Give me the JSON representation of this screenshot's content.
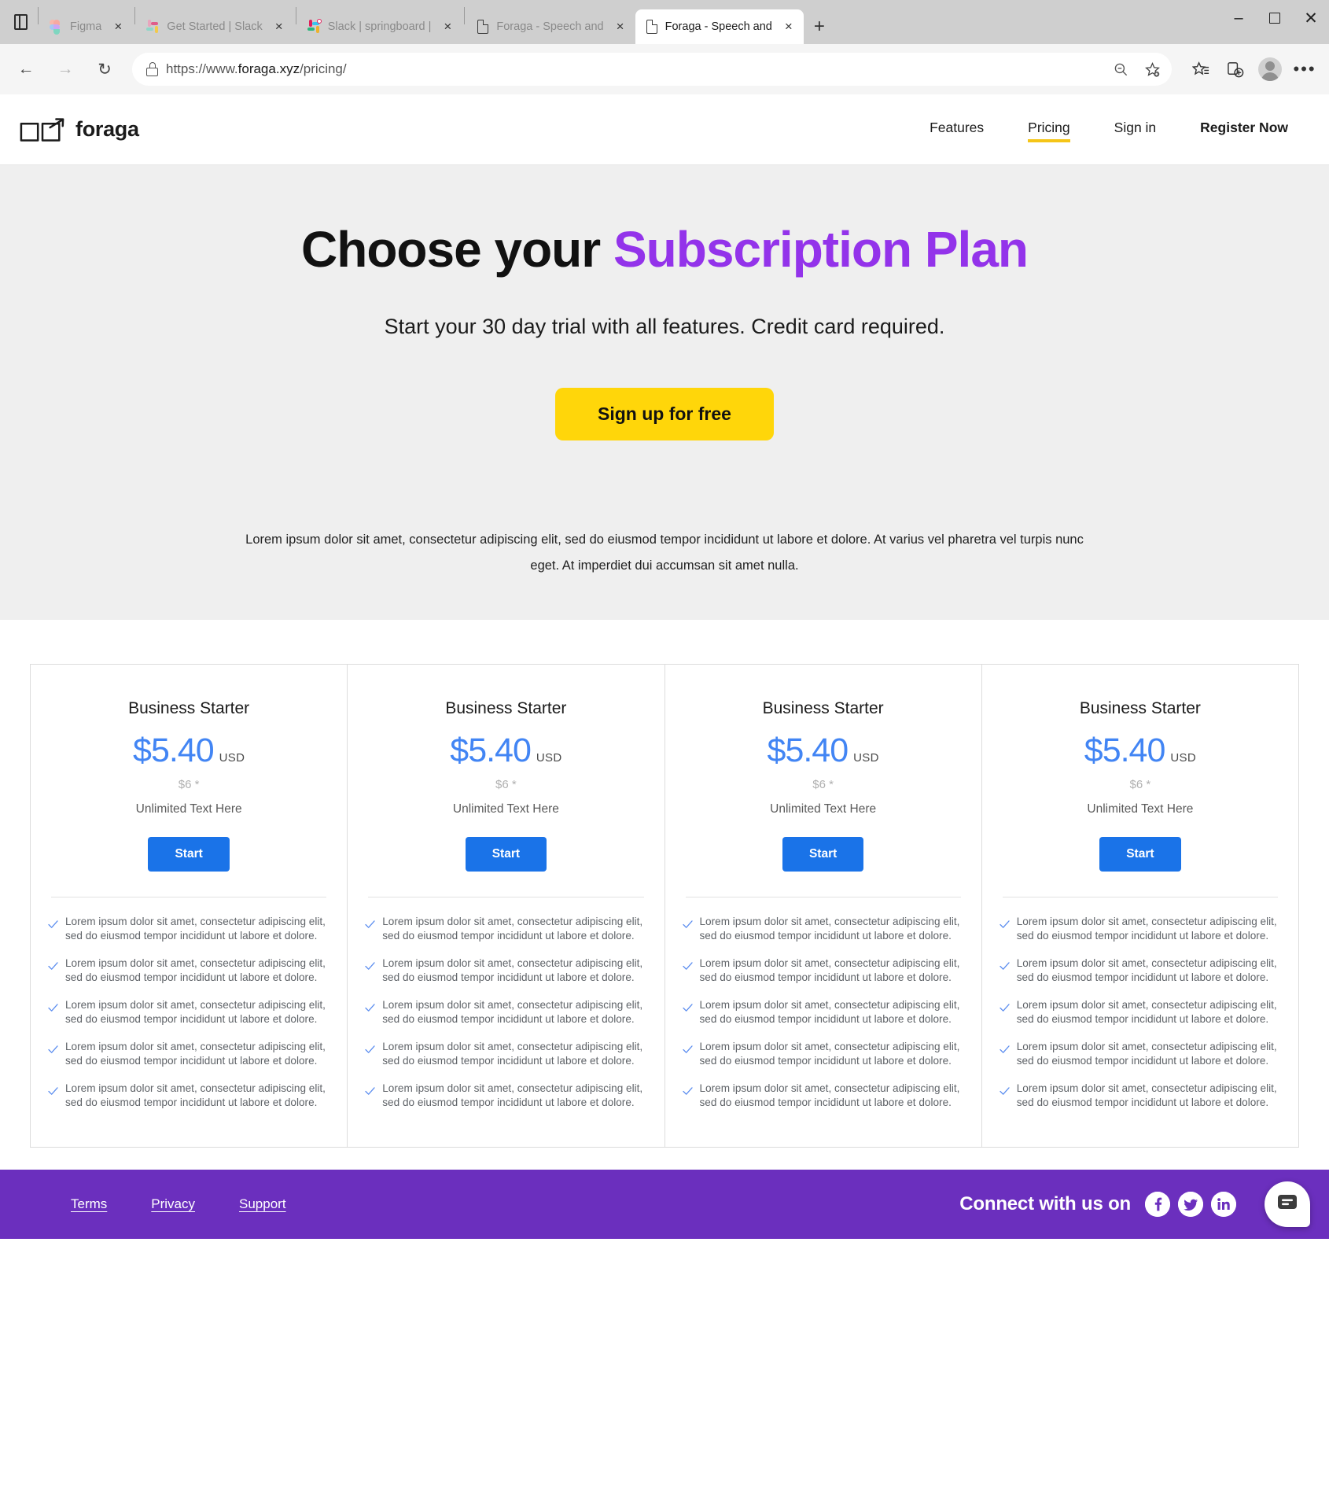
{
  "browser": {
    "tabs": [
      {
        "title": "Figma",
        "favicon": "figma-icon",
        "active": false
      },
      {
        "title": "Get Started | Slack",
        "favicon": "slack-icon",
        "active": false
      },
      {
        "title": "Slack | springboard |",
        "favicon": "slack-icon",
        "active": false
      },
      {
        "title": "Foraga - Speech and",
        "favicon": "document-icon",
        "active": false
      },
      {
        "title": "Foraga - Speech and",
        "favicon": "document-icon",
        "active": true
      }
    ],
    "new_tab_label": "+",
    "close_label": "×",
    "window_controls": {
      "minimize": "–",
      "maximize": "□",
      "close": "✕"
    },
    "nav": {
      "back": "←",
      "forward": "→",
      "reload": "↻",
      "tab_actions_icon": "tab-actions-icon"
    },
    "url": {
      "protocol": "https://www.",
      "host": "foraga.xyz",
      "path": "/pricing/",
      "full": "https://www.foraga.xyz/pricing/"
    },
    "url_actions": [
      {
        "name": "zoom-out-icon",
        "glyph": "⊖"
      },
      {
        "name": "add-favorite-icon",
        "glyph": "☆"
      }
    ],
    "toolbar_icons": [
      {
        "name": "favorites-list-icon",
        "glyph": "☆"
      },
      {
        "name": "collections-icon",
        "glyph": "⊞"
      },
      {
        "name": "profile-avatar",
        "glyph": ""
      },
      {
        "name": "settings-more-icon",
        "glyph": "…"
      }
    ]
  },
  "site": {
    "brand": {
      "name": "foraga",
      "logo_icon": "speech-bubble-arrow-logo"
    },
    "nav": [
      {
        "label": "Features",
        "active": false
      },
      {
        "label": "Pricing",
        "active": true
      },
      {
        "label": "Sign in",
        "active": false
      },
      {
        "label": "Register Now",
        "active": false
      }
    ],
    "accent_colors": {
      "purple": "#9333EA",
      "yellow": "#FFD60A",
      "blue": "#1A73E8",
      "price_blue": "#4285F4",
      "footer_purple": "#6B2FBE",
      "hero_bg": "#EFEFEF"
    }
  },
  "hero": {
    "title_black": "Choose your ",
    "title_accent": "Subscription Plan",
    "subtitle": "Start your 30 day trial with all features. Credit card required.",
    "cta_label": "Sign up for free",
    "blurb": "Lorem ipsum dolor sit amet, consectetur adipiscing elit, sed do eiusmod tempor incididunt ut labore et dolore. At varius vel pharetra vel turpis nunc eget. At imperdiet dui accumsan sit amet nulla."
  },
  "pricing": {
    "feature_text": "Lorem ipsum dolor sit amet, consectetur adipiscing elit, sed do eiusmod tempor incididunt ut labore et dolore.",
    "cards": [
      {
        "title": "Business Starter",
        "price": "$5.40",
        "currency": "USD",
        "was": "$6 *",
        "note": "Unlimited Text Here",
        "button": "Start",
        "features": [
          "Lorem ipsum dolor sit amet, consectetur adipiscing elit, sed do eiusmod tempor incididunt ut labore et dolore.",
          "Lorem ipsum dolor sit amet, consectetur adipiscing elit, sed do eiusmod tempor incididunt ut labore et dolore.",
          "Lorem ipsum dolor sit amet, consectetur adipiscing elit, sed do eiusmod tempor incididunt ut labore et dolore.",
          "Lorem ipsum dolor sit amet, consectetur adipiscing elit, sed do eiusmod tempor incididunt ut labore et dolore.",
          "Lorem ipsum dolor sit amet, consectetur adipiscing elit, sed do eiusmod tempor incididunt ut labore et dolore."
        ]
      },
      {
        "title": "Business Starter",
        "price": "$5.40",
        "currency": "USD",
        "was": "$6 *",
        "note": "Unlimited Text Here",
        "button": "Start",
        "features": [
          "Lorem ipsum dolor sit amet, consectetur adipiscing elit, sed do eiusmod tempor incididunt ut labore et dolore.",
          "Lorem ipsum dolor sit amet, consectetur adipiscing elit, sed do eiusmod tempor incididunt ut labore et dolore.",
          "Lorem ipsum dolor sit amet, consectetur adipiscing elit, sed do eiusmod tempor incididunt ut labore et dolore.",
          "Lorem ipsum dolor sit amet, consectetur adipiscing elit, sed do eiusmod tempor incididunt ut labore et dolore.",
          "Lorem ipsum dolor sit amet, consectetur adipiscing elit, sed do eiusmod tempor incididunt ut labore et dolore."
        ]
      },
      {
        "title": "Business Starter",
        "price": "$5.40",
        "currency": "USD",
        "was": "$6 *",
        "note": "Unlimited Text Here",
        "button": "Start",
        "features": [
          "Lorem ipsum dolor sit amet, consectetur adipiscing elit, sed do eiusmod tempor incididunt ut labore et dolore.",
          "Lorem ipsum dolor sit amet, consectetur adipiscing elit, sed do eiusmod tempor incididunt ut labore et dolore.",
          "Lorem ipsum dolor sit amet, consectetur adipiscing elit, sed do eiusmod tempor incididunt ut labore et dolore.",
          "Lorem ipsum dolor sit amet, consectetur adipiscing elit, sed do eiusmod tempor incididunt ut labore et dolore.",
          "Lorem ipsum dolor sit amet, consectetur adipiscing elit, sed do eiusmod tempor incididunt ut labore et dolore."
        ]
      },
      {
        "title": "Business Starter",
        "price": "$5.40",
        "currency": "USD",
        "was": "$6 *",
        "note": "Unlimited Text Here",
        "button": "Start",
        "features": [
          "Lorem ipsum dolor sit amet, consectetur adipiscing elit, sed do eiusmod tempor incididunt ut labore et dolore.",
          "Lorem ipsum dolor sit amet, consectetur adipiscing elit, sed do eiusmod tempor incididunt ut labore et dolore.",
          "Lorem ipsum dolor sit amet, consectetur adipiscing elit, sed do eiusmod tempor incididunt ut labore et dolore.",
          "Lorem ipsum dolor sit amet, consectetur adipiscing elit, sed do eiusmod tempor incididunt ut labore et dolore.",
          "Lorem ipsum dolor sit amet, consectetur adipiscing elit, sed do eiusmod tempor incididunt ut labore et dolore."
        ]
      }
    ]
  },
  "footer": {
    "links": [
      {
        "label": "Terms"
      },
      {
        "label": "Privacy"
      },
      {
        "label": "Support"
      }
    ],
    "connect_label": "Connect with us on",
    "socials": [
      {
        "name": "facebook-icon"
      },
      {
        "name": "twitter-icon"
      },
      {
        "name": "linkedin-icon"
      }
    ],
    "chat_widget_icon": "chat-bubble-icon"
  }
}
